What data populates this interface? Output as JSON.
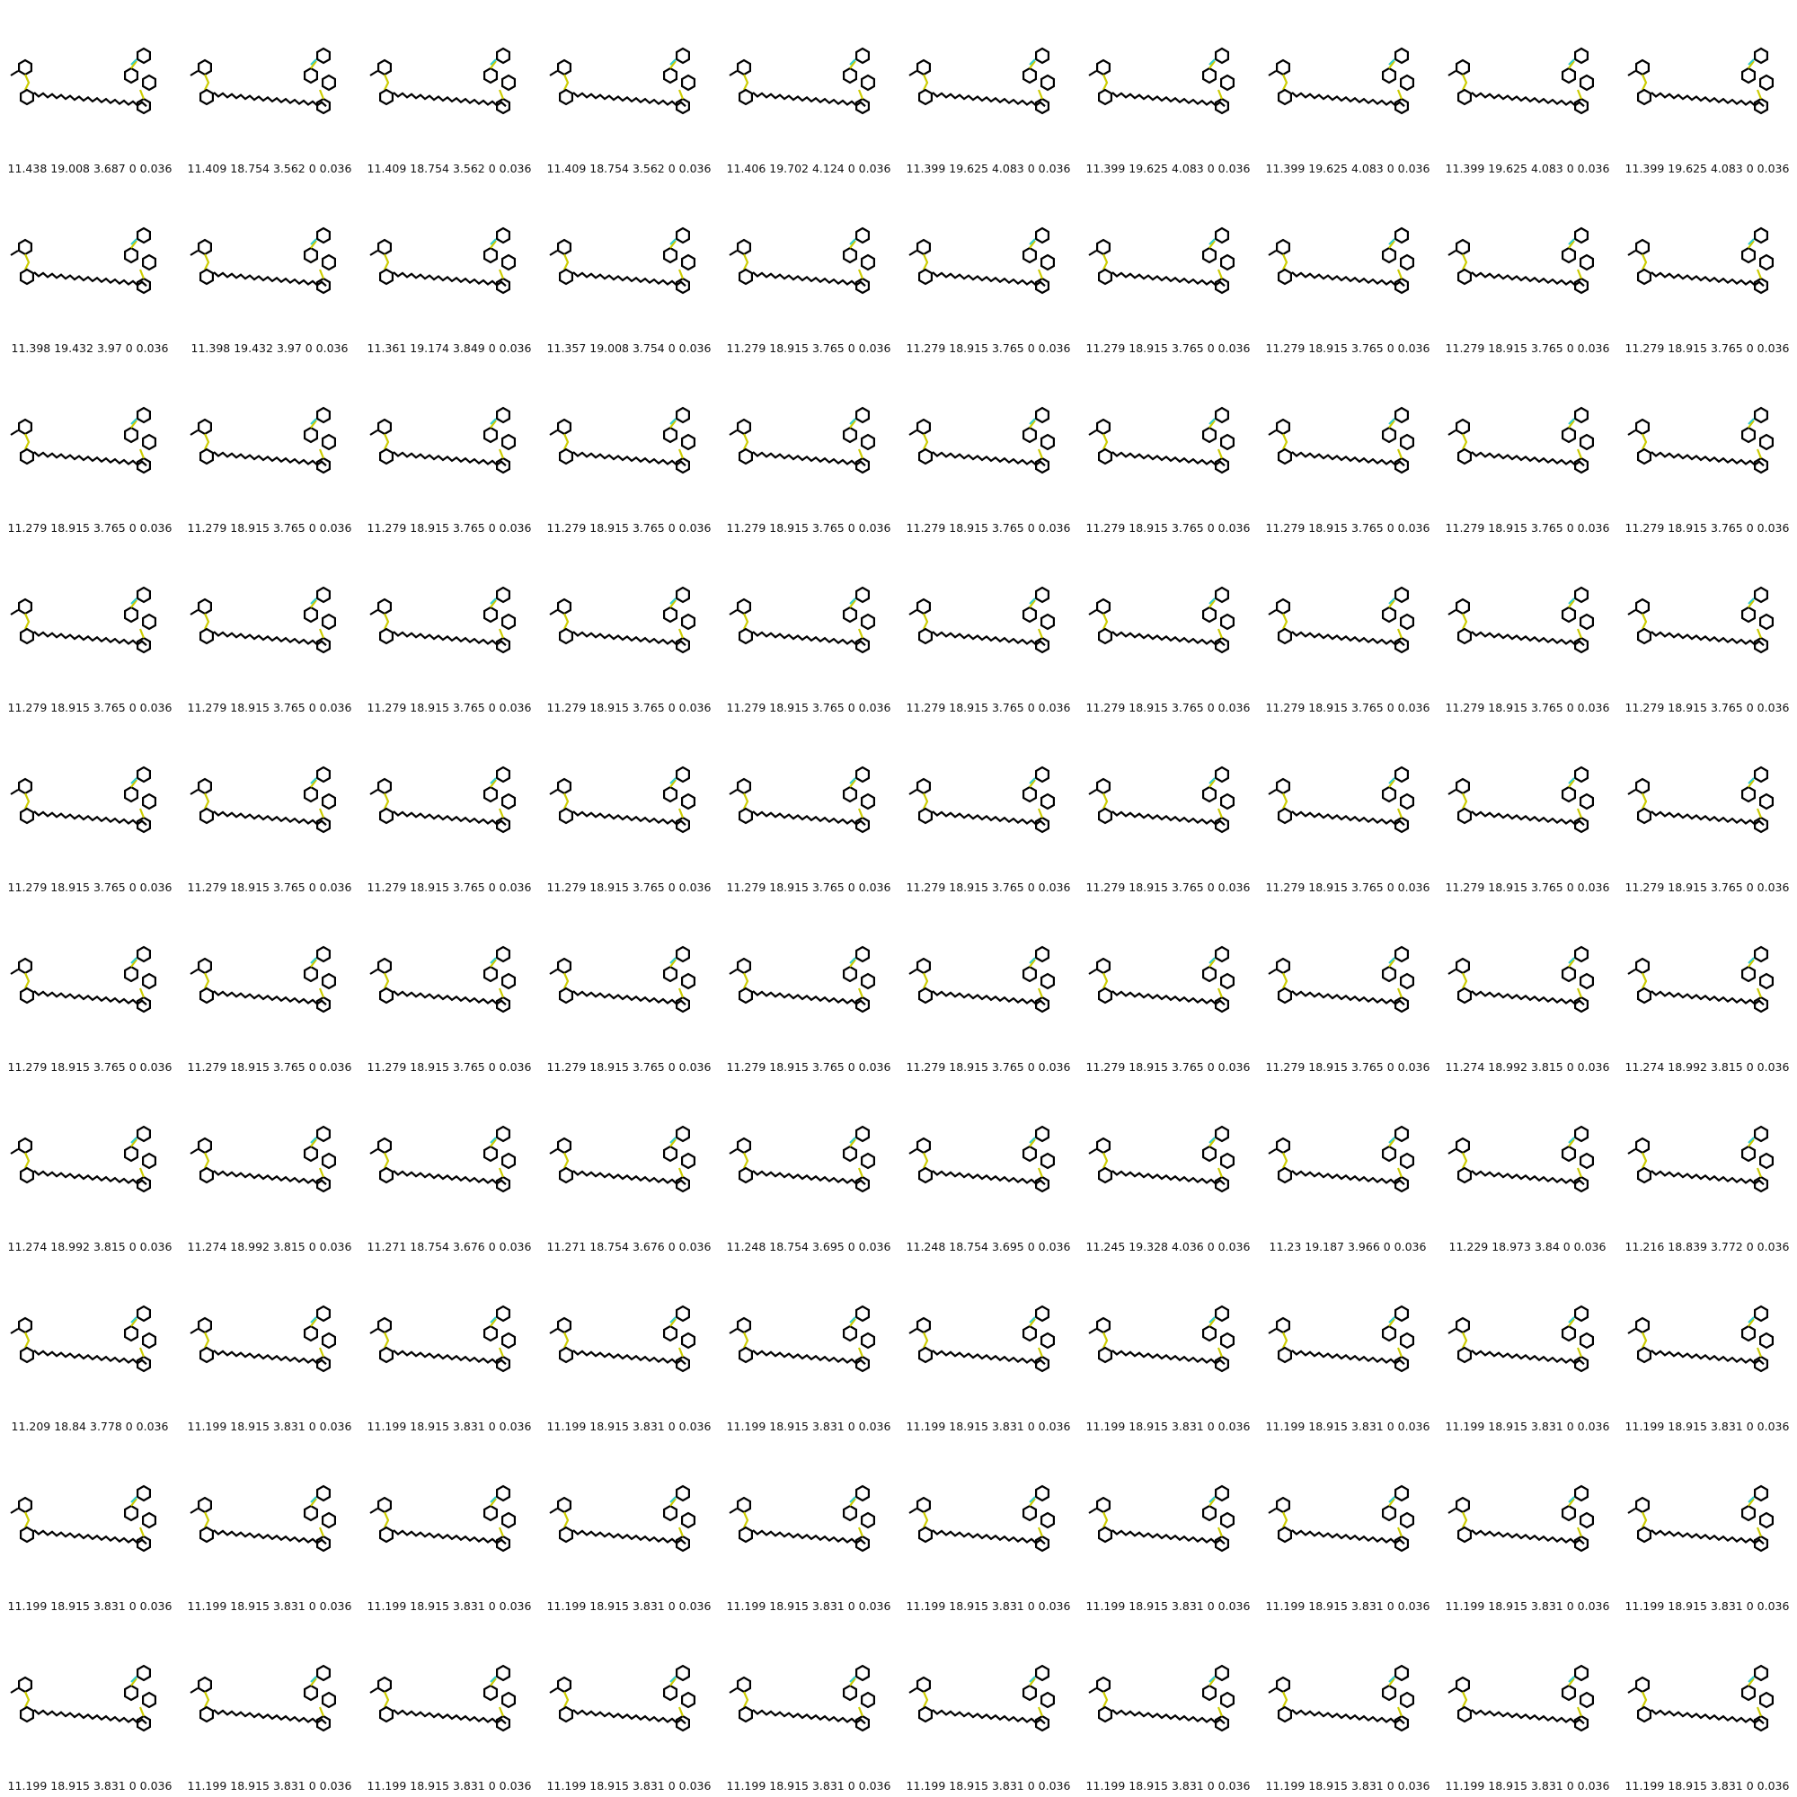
{
  "colors": {
    "bond": "#000000",
    "sulfur": "#cccc00",
    "oxygen": "#ff0000",
    "fluorine": "#33cccc",
    "nitrogen": "#3333ff"
  },
  "labels": [
    "11.438 19.008 3.687 0 0.036",
    "11.409 18.754 3.562 0 0.036",
    "11.409 18.754 3.562 0 0.036",
    "11.409 18.754 3.562 0 0.036",
    "11.406 19.702 4.124 0 0.036",
    "11.399 19.625 4.083 0 0.036",
    "11.399 19.625 4.083 0 0.036",
    "11.399 19.625 4.083 0 0.036",
    "11.399 19.625 4.083 0 0.036",
    "11.399 19.625 4.083 0 0.036",
    "11.398 19.432 3.97 0 0.036",
    "11.398 19.432 3.97 0 0.036",
    "11.361 19.174 3.849 0 0.036",
    "11.357 19.008 3.754 0 0.036",
    "11.279 18.915 3.765 0 0.036",
    "11.279 18.915 3.765 0 0.036",
    "11.279 18.915 3.765 0 0.036",
    "11.279 18.915 3.765 0 0.036",
    "11.279 18.915 3.765 0 0.036",
    "11.279 18.915 3.765 0 0.036",
    "11.279 18.915 3.765 0 0.036",
    "11.279 18.915 3.765 0 0.036",
    "11.279 18.915 3.765 0 0.036",
    "11.279 18.915 3.765 0 0.036",
    "11.279 18.915 3.765 0 0.036",
    "11.279 18.915 3.765 0 0.036",
    "11.279 18.915 3.765 0 0.036",
    "11.279 18.915 3.765 0 0.036",
    "11.279 18.915 3.765 0 0.036",
    "11.279 18.915 3.765 0 0.036",
    "11.279 18.915 3.765 0 0.036",
    "11.279 18.915 3.765 0 0.036",
    "11.279 18.915 3.765 0 0.036",
    "11.279 18.915 3.765 0 0.036",
    "11.279 18.915 3.765 0 0.036",
    "11.279 18.915 3.765 0 0.036",
    "11.279 18.915 3.765 0 0.036",
    "11.279 18.915 3.765 0 0.036",
    "11.279 18.915 3.765 0 0.036",
    "11.279 18.915 3.765 0 0.036",
    "11.279 18.915 3.765 0 0.036",
    "11.279 18.915 3.765 0 0.036",
    "11.279 18.915 3.765 0 0.036",
    "11.279 18.915 3.765 0 0.036",
    "11.279 18.915 3.765 0 0.036",
    "11.279 18.915 3.765 0 0.036",
    "11.279 18.915 3.765 0 0.036",
    "11.279 18.915 3.765 0 0.036",
    "11.279 18.915 3.765 0 0.036",
    "11.279 18.915 3.765 0 0.036",
    "11.279 18.915 3.765 0 0.036",
    "11.279 18.915 3.765 0 0.036",
    "11.279 18.915 3.765 0 0.036",
    "11.279 18.915 3.765 0 0.036",
    "11.279 18.915 3.765 0 0.036",
    "11.279 18.915 3.765 0 0.036",
    "11.279 18.915 3.765 0 0.036",
    "11.279 18.915 3.765 0 0.036",
    "11.274 18.992 3.815 0 0.036",
    "11.274 18.992 3.815 0 0.036",
    "11.274 18.992 3.815 0 0.036",
    "11.274 18.992 3.815 0 0.036",
    "11.271 18.754 3.676 0 0.036",
    "11.271 18.754 3.676 0 0.036",
    "11.248 18.754 3.695 0 0.036",
    "11.248 18.754 3.695 0 0.036",
    "11.245 19.328 4.036 0 0.036",
    "11.23 19.187 3.966 0 0.036",
    "11.229 18.973 3.84 0 0.036",
    "11.216 18.839 3.772 0 0.036",
    "11.209 18.84 3.778 0 0.036",
    "11.199 18.915 3.831 0 0.036",
    "11.199 18.915 3.831 0 0.036",
    "11.199 18.915 3.831 0 0.036",
    "11.199 18.915 3.831 0 0.036",
    "11.199 18.915 3.831 0 0.036",
    "11.199 18.915 3.831 0 0.036",
    "11.199 18.915 3.831 0 0.036",
    "11.199 18.915 3.831 0 0.036",
    "11.199 18.915 3.831 0 0.036",
    "11.199 18.915 3.831 0 0.036",
    "11.199 18.915 3.831 0 0.036",
    "11.199 18.915 3.831 0 0.036",
    "11.199 18.915 3.831 0 0.036",
    "11.199 18.915 3.831 0 0.036",
    "11.199 18.915 3.831 0 0.036",
    "11.199 18.915 3.831 0 0.036",
    "11.199 18.915 3.831 0 0.036",
    "11.199 18.915 3.831 0 0.036",
    "11.199 18.915 3.831 0 0.036",
    "11.199 18.915 3.831 0 0.036",
    "11.199 18.915 3.831 0 0.036",
    "11.199 18.915 3.831 0 0.036",
    "11.199 18.915 3.831 0 0.036",
    "11.199 18.915 3.831 0 0.036",
    "11.199 18.915 3.831 0 0.036",
    "11.199 18.915 3.831 0 0.036",
    "11.199 18.915 3.831 0 0.036",
    "11.199 18.915 3.831 0 0.036",
    "11.199 18.915 3.831 0 0.036"
  ]
}
